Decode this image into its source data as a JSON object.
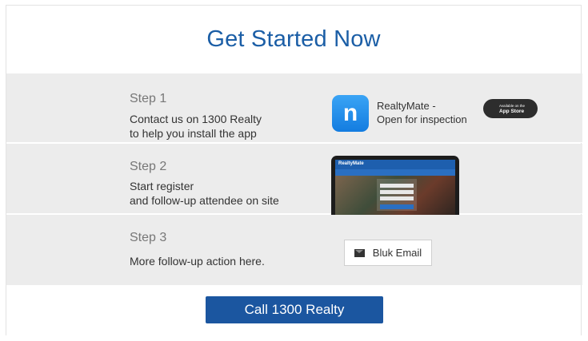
{
  "header": {
    "title": "Get Started Now"
  },
  "steps": [
    {
      "label": "Step 1",
      "desc_line1": "Contact us on 1300 Realty",
      "desc_line2": "to help you install the app",
      "app": {
        "icon_letter": "n",
        "name_line1": "RealtyMate -",
        "name_line2": "Open for inspection"
      },
      "store_badge": {
        "small": "Available on the",
        "big": "App Store"
      }
    },
    {
      "label": "Step 2",
      "desc_line1": "Start register",
      "desc_line2": "and follow-up attendee on site",
      "tablet": {
        "logo": "RealtyMate"
      }
    },
    {
      "label": "Step 3",
      "desc_line1": "More follow-up action here.",
      "email_button": {
        "label": "Bluk Email",
        "icon": "envelope-icon"
      }
    }
  ],
  "footer": {
    "call_button": "Call 1300 Realty"
  },
  "colors": {
    "accent": "#1b5ea6",
    "button": "#1b56a0",
    "band": "#ececec"
  }
}
